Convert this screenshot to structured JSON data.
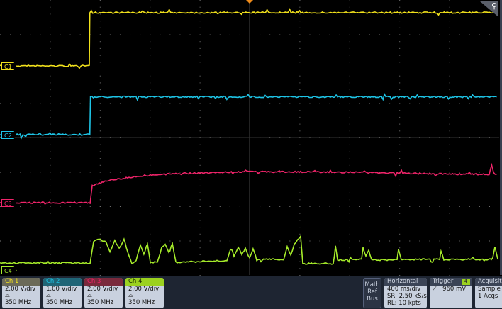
{
  "horizontal": {
    "label": "Horizontal",
    "scale": "400 ms/div",
    "sample_rate": "SR: 2.50 kS/s",
    "record_length": "RL: 10 kpts"
  },
  "trigger": {
    "label": "Trigger",
    "source": "4",
    "level": "960 mV",
    "slope_icon": "rising-edge-icon"
  },
  "acquisition": {
    "label": "Acquisit",
    "mode": "Sample",
    "count": "1 Acqs"
  },
  "math_ref_bus": {
    "math": "Math",
    "ref": "Ref",
    "bus": "Bus"
  },
  "channels": [
    {
      "marker": "C1",
      "label": "Ch 1",
      "scale": "2.00 V/div",
      "bandwidth": "350 MHz",
      "color": "#f2e21c",
      "header": "#6b6a58",
      "volts_per_div": 2,
      "points": [
        [
          -2,
          0
        ],
        [
          -1.284,
          0
        ],
        [
          -1.28,
          3.1
        ],
        [
          1.98,
          3.1
        ]
      ]
    },
    {
      "marker": "C2",
      "label": "Ch 2",
      "scale": "1.00 V/div",
      "bandwidth": "350 MHz",
      "color": "#1ec4e6",
      "header": "#1f6577",
      "volts_per_div": 1,
      "points": [
        [
          -2,
          0
        ],
        [
          -1.28,
          0
        ],
        [
          -1.275,
          1.1
        ],
        [
          1.98,
          1.1
        ]
      ]
    },
    {
      "marker": "C3",
      "label": "Ch 3",
      "scale": "2.00 V/div",
      "bandwidth": "350 MHz",
      "color": "#f0246a",
      "header": "#7a2a3c",
      "volts_per_div": 2,
      "points": [
        [
          -2,
          0
        ],
        [
          -1.278,
          0
        ],
        [
          -1.261,
          0.99
        ],
        [
          -1.148,
          1.28
        ],
        [
          -0.864,
          1.57
        ],
        [
          -0.58,
          1.69
        ],
        [
          -0.01,
          1.81
        ],
        [
          0.84,
          1.77
        ],
        [
          1.41,
          1.69
        ],
        [
          1.92,
          1.65
        ],
        [
          1.94,
          2.18
        ],
        [
          1.955,
          1.65
        ],
        [
          1.98,
          1.65
        ]
      ]
    },
    {
      "marker": "C4",
      "label": "Ch 4",
      "scale": "2.00 V/div",
      "bandwidth": "350 MHz",
      "color": "#a6ec2a",
      "header": "#9bd11f",
      "volts_per_div": 2,
      "points": [
        [
          -2,
          0.41
        ],
        [
          -1.278,
          0.41
        ],
        [
          -1.25,
          1.69
        ],
        [
          -1.205,
          1.81
        ],
        [
          -1.148,
          1.61
        ],
        [
          -1.119,
          1.07
        ],
        [
          -1.08,
          1.69
        ],
        [
          -1.045,
          1.28
        ],
        [
          -1.006,
          1.77
        ],
        [
          -0.977,
          1.07
        ],
        [
          -0.943,
          0.37
        ],
        [
          -0.909,
          0.54
        ],
        [
          -0.875,
          1.48
        ],
        [
          -0.847,
          0.95
        ],
        [
          -0.818,
          1.53
        ],
        [
          -0.795,
          0.45
        ],
        [
          -0.739,
          0.45
        ],
        [
          -0.705,
          1.28
        ],
        [
          -0.676,
          1.53
        ],
        [
          -0.648,
          1.07
        ],
        [
          -0.619,
          1.57
        ],
        [
          -0.591,
          0.45
        ],
        [
          -0.182,
          0.54
        ],
        [
          -0.153,
          1.2
        ],
        [
          -0.125,
          0.78
        ],
        [
          -0.091,
          1.36
        ],
        [
          -0.063,
          0.87
        ],
        [
          -0.034,
          1.28
        ],
        [
          0,
          0.7
        ],
        [
          0.028,
          1.2
        ],
        [
          0.057,
          0.62
        ],
        [
          0.273,
          0.62
        ],
        [
          0.301,
          1.36
        ],
        [
          0.33,
          0.87
        ],
        [
          0.358,
          1.48
        ],
        [
          0.409,
          1.98
        ],
        [
          0.426,
          0.37
        ],
        [
          0.67,
          0.37
        ],
        [
          0.688,
          1.28
        ],
        [
          0.705,
          0.58
        ],
        [
          0.898,
          0.62
        ],
        [
          0.909,
          1.28
        ],
        [
          0.932,
          0.78
        ],
        [
          0.955,
          1.2
        ],
        [
          0.977,
          0.58
        ],
        [
          1.182,
          0.58
        ],
        [
          1.193,
          1.2
        ],
        [
          1.216,
          0.62
        ],
        [
          1.523,
          0.62
        ],
        [
          1.534,
          1.07
        ],
        [
          1.557,
          0.62
        ],
        [
          1.949,
          0.62
        ],
        [
          1.966,
          1.36
        ],
        [
          1.989,
          0.62
        ]
      ]
    }
  ],
  "colors": {
    "trigger_marker": "#f08c1a",
    "grid": "#555555",
    "panel": "#1e2532",
    "box": "#c9d1df"
  }
}
